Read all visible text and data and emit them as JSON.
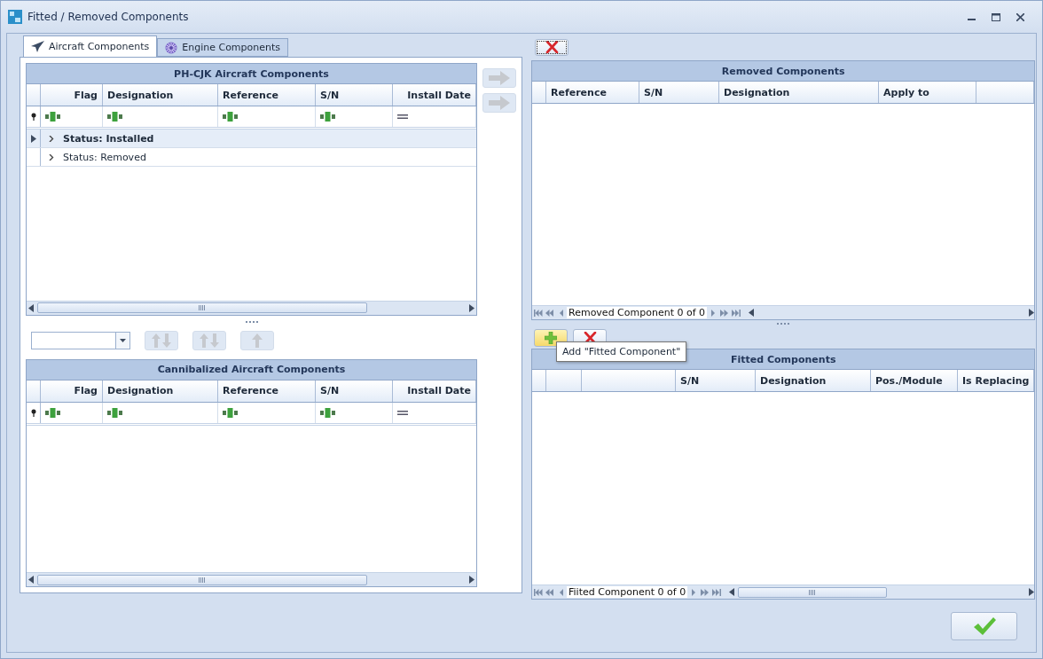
{
  "window": {
    "title": "Fitted / Removed Components"
  },
  "tabs": [
    {
      "label": "Aircraft Components",
      "kind": "aircraft",
      "selected": true
    },
    {
      "label": "Engine Components",
      "kind": "engine",
      "selected": false
    }
  ],
  "aircraft_grid": {
    "title": "PH-CJK Aircraft Components",
    "columns": [
      "Flag",
      "Designation",
      "Reference",
      "S/N",
      "Install Date"
    ],
    "filter_row": [
      {
        "kind": "text"
      },
      {
        "kind": "text"
      },
      {
        "kind": "text"
      },
      {
        "kind": "text"
      },
      {
        "kind": "date"
      }
    ],
    "groups": [
      {
        "label": "Status: Installed",
        "selected": true,
        "expanded": false
      },
      {
        "label": "Status: Removed",
        "selected": false,
        "expanded": false
      }
    ]
  },
  "transfer_buttons": [
    {
      "kind": "right",
      "disabled": true
    },
    {
      "kind": "right",
      "disabled": true
    }
  ],
  "swap_buttons": [
    {
      "kind": "swap",
      "disabled": true
    },
    {
      "kind": "swap",
      "disabled": true
    },
    {
      "kind": "up",
      "disabled": true
    }
  ],
  "cannibalized_grid": {
    "title": "Cannibalized Aircraft Components",
    "columns": [
      "Flag",
      "Designation",
      "Reference",
      "S/N",
      "Install Date"
    ],
    "filter_row": [
      {
        "kind": "text"
      },
      {
        "kind": "text"
      },
      {
        "kind": "text"
      },
      {
        "kind": "text"
      },
      {
        "kind": "date"
      }
    ]
  },
  "removed_grid": {
    "title": "Removed Components",
    "columns": [
      "Reference",
      "S/N",
      "Designation",
      "Apply to"
    ],
    "navigator": "Removed Component 0 of 0"
  },
  "fitted_toolbar": [
    {
      "kind": "add",
      "hovered": true
    },
    {
      "kind": "delete",
      "hovered": false
    }
  ],
  "tooltip": "Add \"Fitted Component\"",
  "fitted_grid": {
    "title": "Fitted Components",
    "columns": [
      "S/N",
      "Designation",
      "Pos./Module",
      "Is Replacing"
    ],
    "navigator": "Fiited Component 0 of 0"
  }
}
